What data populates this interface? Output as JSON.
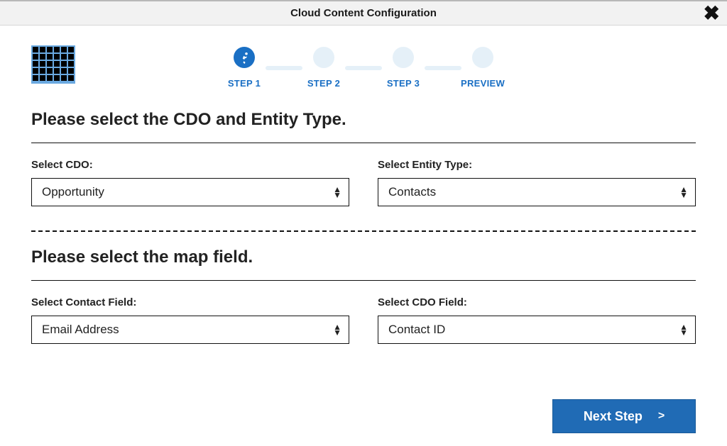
{
  "header": {
    "title": "Cloud Content Configuration"
  },
  "stepper": {
    "steps": [
      {
        "label": "STEP 1",
        "active": true
      },
      {
        "label": "STEP 2",
        "active": false
      },
      {
        "label": "STEP 3",
        "active": false
      },
      {
        "label": "PREVIEW",
        "active": false
      }
    ]
  },
  "section1": {
    "heading": "Please select the CDO and Entity Type.",
    "cdo": {
      "label": "Select CDO:",
      "value": "Opportunity"
    },
    "entity": {
      "label": "Select Entity Type:",
      "value": "Contacts"
    }
  },
  "section2": {
    "heading": "Please select the map field.",
    "contactField": {
      "label": "Select Contact Field:",
      "value": "Email Address"
    },
    "cdoField": {
      "label": "Select CDO Field:",
      "value": "Contact ID"
    }
  },
  "footer": {
    "next": "Next Step"
  }
}
